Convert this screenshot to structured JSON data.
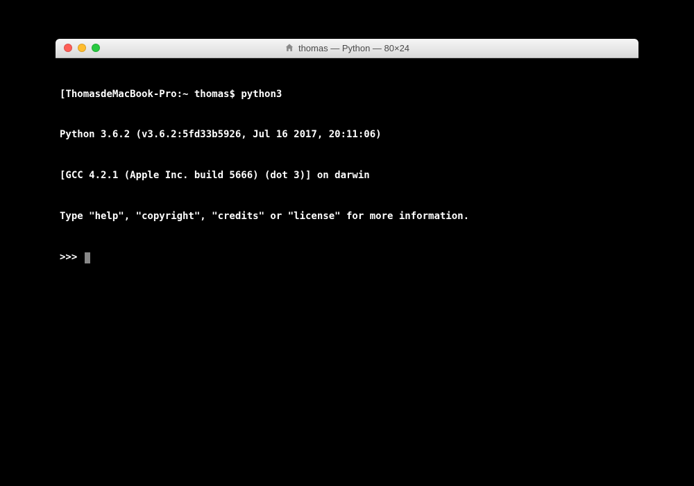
{
  "window": {
    "title": "thomas — Python — 80×24"
  },
  "terminal": {
    "shell_prompt": "ThomasdeMacBook-Pro:~ thomas$ ",
    "command": "python3",
    "output_line1": "Python 3.6.2 (v3.6.2:5fd33b5926, Jul 16 2017, 20:11:06)",
    "output_line2": "[GCC 4.2.1 (Apple Inc. build 5666) (dot 3)] on darwin",
    "output_line3": "Type \"help\", \"copyright\", \"credits\" or \"license\" for more information.",
    "repl_prompt": ">>> "
  }
}
